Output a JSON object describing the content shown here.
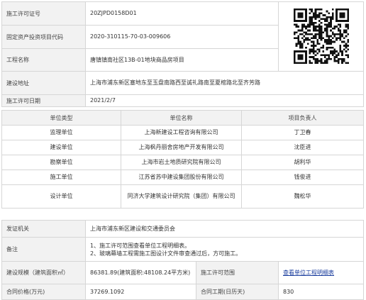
{
  "permit": {
    "permit_no_label": "施工许可证号",
    "permit_no": "20ZJPD0158D01",
    "project_code_label": "固定资产投资项目代码",
    "project_code": "2020-310115-70-03-009606",
    "project_name_label": "工程名称",
    "project_name": "唐镇镇南社区13B-01地块商品房项目",
    "address_label": "建设地址",
    "address": "上海市浦东新区塞地东至玉盘南路西至诚礼路南至夏棺路北至齐芳路",
    "permit_date_label": "施工许可日期",
    "permit_date": "2021/2/7"
  },
  "units": {
    "headers": [
      "单位类型",
      "单位名称",
      "项目负责人"
    ],
    "rows": [
      {
        "type": "监理单位",
        "name": "上海新建设工程咨询有限公司",
        "manager": "丁卫春"
      },
      {
        "type": "建设单位",
        "name": "上海枫丹丽舍房地产开发有限公司",
        "manager": "沈臣进"
      },
      {
        "type": "勘察单位",
        "name": "上海市岩土地质研究院有限公司",
        "manager": "胡利华"
      },
      {
        "type": "施工单位",
        "name": "江苏省苏中建设集团股份有限公司",
        "manager": "钱俊进"
      },
      {
        "type": "设计单位",
        "name": "同济大学建筑设计研究院（集团）有限公司",
        "manager": "魏松华"
      }
    ]
  },
  "details": {
    "issuer_label": "发证机关",
    "issuer": "上海市浦东新区建设和交通委员会",
    "remarks_label": "备注",
    "remark_1": "1、施工许可范围查看单位工程明细表。",
    "remark_2": "2、玻璃幕墙工程需施工图设计文件审查通过后，方可施工。",
    "scale_label": "建设规模（建筑面积㎡）",
    "scale": "86381.89(建筑面积:48108.24平方米)",
    "scope_label": "施工许可范围",
    "scope_link": "查看单位工程明细表",
    "price_label": "合同价格(万元)",
    "price": "37269.1092",
    "duration_label": "合同工期(日历天)",
    "duration": "830"
  },
  "colors": {
    "label_bg": "#f2f2f2",
    "border": "#d6d6d6",
    "link": "#1b3e9e"
  }
}
